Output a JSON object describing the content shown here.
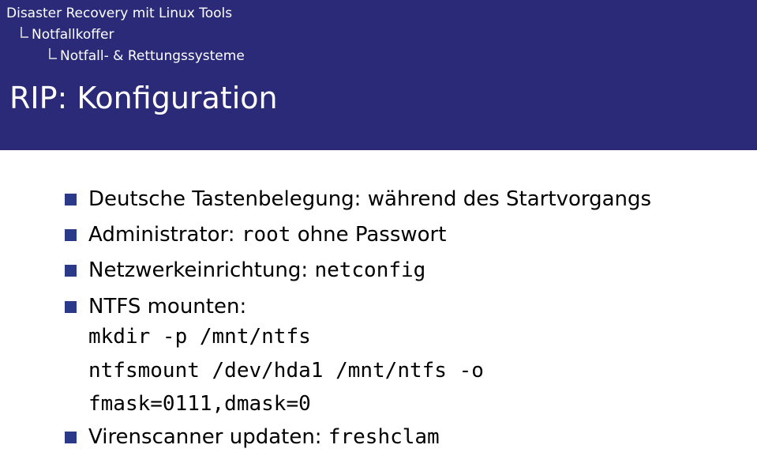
{
  "breadcrumb": {
    "level0": "Disaster Recovery mit Linux Tools",
    "level1": "Notfallkoffer",
    "level2": "Notfall- & Rettungssysteme"
  },
  "slide": {
    "title": "RIP: Konfiguration"
  },
  "bullets": {
    "item0": {
      "text": "Deutsche Tastenbelegung: während des Startvorgangs"
    },
    "item1": {
      "prefix": "Administrator: ",
      "code": "root",
      "suffix": " ohne Passwort"
    },
    "item2": {
      "prefix": "Netzwerkeinrichtung: ",
      "code": "netconfig"
    },
    "item3": {
      "text": "NTFS mounten:",
      "code_line1": "mkdir -p /mnt/ntfs",
      "code_line2": "ntfsmount /dev/hda1 /mnt/ntfs -o",
      "code_line3": "fmask=0111,dmask=0"
    },
    "item4": {
      "prefix": "Virenscanner updaten: ",
      "code": "freshclam"
    }
  }
}
